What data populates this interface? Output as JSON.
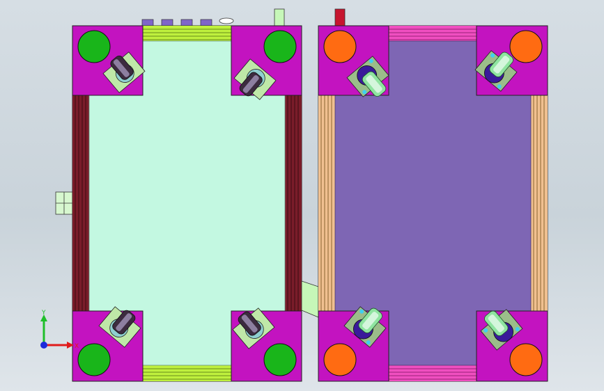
{
  "viewport": {
    "background_top": "#d6dee4",
    "background_bottom": "#dfe5ea"
  },
  "model": {
    "left_cart": {
      "frame_color": "#c313c0",
      "deck_color": "#c3f8e1",
      "rail_color": "#7a1c2a",
      "crossbar_color": "#bff03d",
      "corner_disc_color": "#19b51a",
      "caster_plate_color": "#bfe8a8",
      "caster_wheel_color": "#3c2b3f"
    },
    "right_cart": {
      "frame_color": "#c313c0",
      "deck_color": "#7e66b4",
      "rail_color": "#f0c090",
      "crossbar_color": "#f04fc0",
      "corner_disc_color": "#ff6b12",
      "caster_plate_color": "#9bbd8a",
      "caster_wheel_color": "#8fe4a0"
    }
  },
  "triad": {
    "y_label": "Y",
    "x_label": "X",
    "y_color": "#1fbf2a",
    "x_color": "#e01b1b",
    "origin_color": "#1c2bdb"
  }
}
